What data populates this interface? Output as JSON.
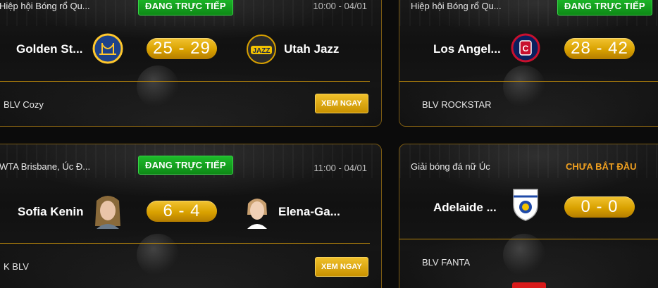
{
  "matches": [
    {
      "league": "Hiệp hội Bóng rổ Qu...",
      "status": "ĐANG TRỰC TIẾP",
      "time": "10:00 - 04/01",
      "home": "Golden St...",
      "away": "Utah Jazz",
      "score": "25 - 29",
      "commentator": "BLV Cozy",
      "watch_label": "XEM NGAY"
    },
    {
      "league": "Hiệp hội Bóng rổ Qu...",
      "status": "ĐANG TRỰC TIẾP",
      "home": "Los Angel...",
      "score": "28 - 42",
      "commentator": "BLV ROCKSTAR"
    },
    {
      "league": "WTA Brisbane, Úc Đ...",
      "status": "ĐANG TRỰC TIẾP",
      "time": "11:00 - 04/01",
      "home": "Sofia Kenin",
      "away": "Elena-Ga...",
      "score": "6 - 4",
      "commentator": "K BLV",
      "watch_label": "XEM NGAY"
    },
    {
      "league": "Giải bóng đá nữ Úc",
      "status": "CHƯA BẮT ĐẦU",
      "home": "Adelaide ...",
      "score": "0 - 0",
      "commentator": "BLV FANTA"
    }
  ],
  "colors": {
    "accent_gold": "#d9a100",
    "live_green": "#1dbb2a",
    "not_started_orange": "#f0a020"
  },
  "icons": {
    "golden_state": "golden-state-warriors-logo",
    "utah_jazz": "utah-jazz-logo",
    "la_clippers": "la-clippers-logo",
    "adelaide": "adelaide-united-logo",
    "player1": "player-avatar",
    "player2": "player-avatar"
  }
}
